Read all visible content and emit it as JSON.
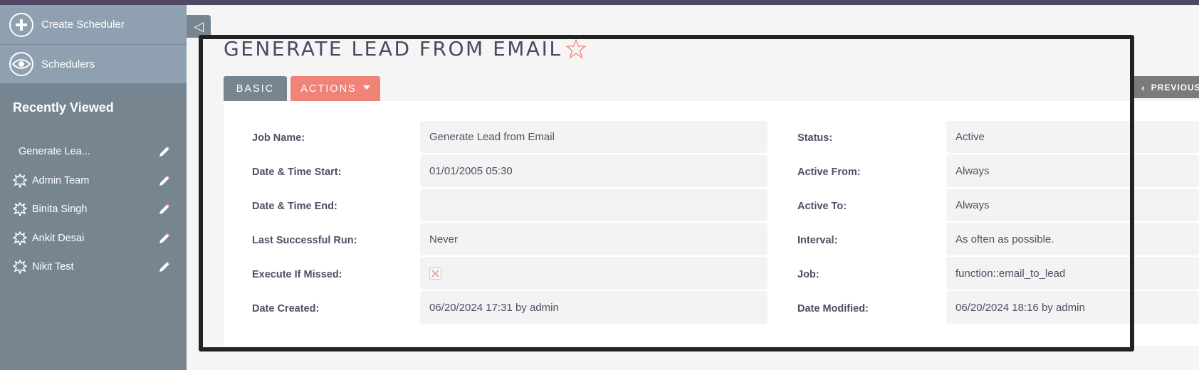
{
  "sidebar": {
    "actions": [
      {
        "label": "Create Scheduler",
        "icon": "plus-icon"
      },
      {
        "label": "Schedulers",
        "icon": "eye-icon"
      }
    ],
    "recent_heading": "Recently Viewed",
    "recent_items": [
      {
        "label": "Generate Lea...",
        "icon": "none"
      },
      {
        "label": "Admin Team",
        "icon": "star-burst-icon"
      },
      {
        "label": "Binita Singh",
        "icon": "star-burst-icon"
      },
      {
        "label": "Ankit Desai",
        "icon": "star-burst-icon"
      },
      {
        "label": "Nikit Test",
        "icon": "star-burst-icon"
      }
    ]
  },
  "collapse_icon": "◁",
  "page": {
    "title": "GENERATE LEAD FROM EMAIL",
    "favorite": false
  },
  "tabs": {
    "basic": "BASIC",
    "actions": "ACTIONS"
  },
  "nav": {
    "previous": "PREVIOUS"
  },
  "fields_left": [
    {
      "label": "Job Name:",
      "value": "Generate Lead from Email"
    },
    {
      "label": "Date & Time Start:",
      "value": "01/01/2005 05:30"
    },
    {
      "label": "Date & Time End:",
      "value": ""
    },
    {
      "label": "Last Successful Run:",
      "value": "Never"
    },
    {
      "label": "Execute If Missed:",
      "value": "",
      "checkbox": false
    },
    {
      "label": "Date Created:",
      "value": "06/20/2024 17:31 by admin"
    }
  ],
  "fields_right": [
    {
      "label": "Status:",
      "value": "Active"
    },
    {
      "label": "Active From:",
      "value": "Always"
    },
    {
      "label": "Active To:",
      "value": "Always"
    },
    {
      "label": "Interval:",
      "value": "As often as possible."
    },
    {
      "label": "Job:",
      "value": "function::email_to_lead"
    },
    {
      "label": "Date Modified:",
      "value": "06/20/2024 18:16 by admin"
    }
  ],
  "colors": {
    "topbar": "#4f4763",
    "sidebar": "#778591",
    "sidebar_actions": "#8fa1b0",
    "actions_button": "#f08377",
    "basic_tab": "#778591",
    "highlight_box": "#222222"
  }
}
